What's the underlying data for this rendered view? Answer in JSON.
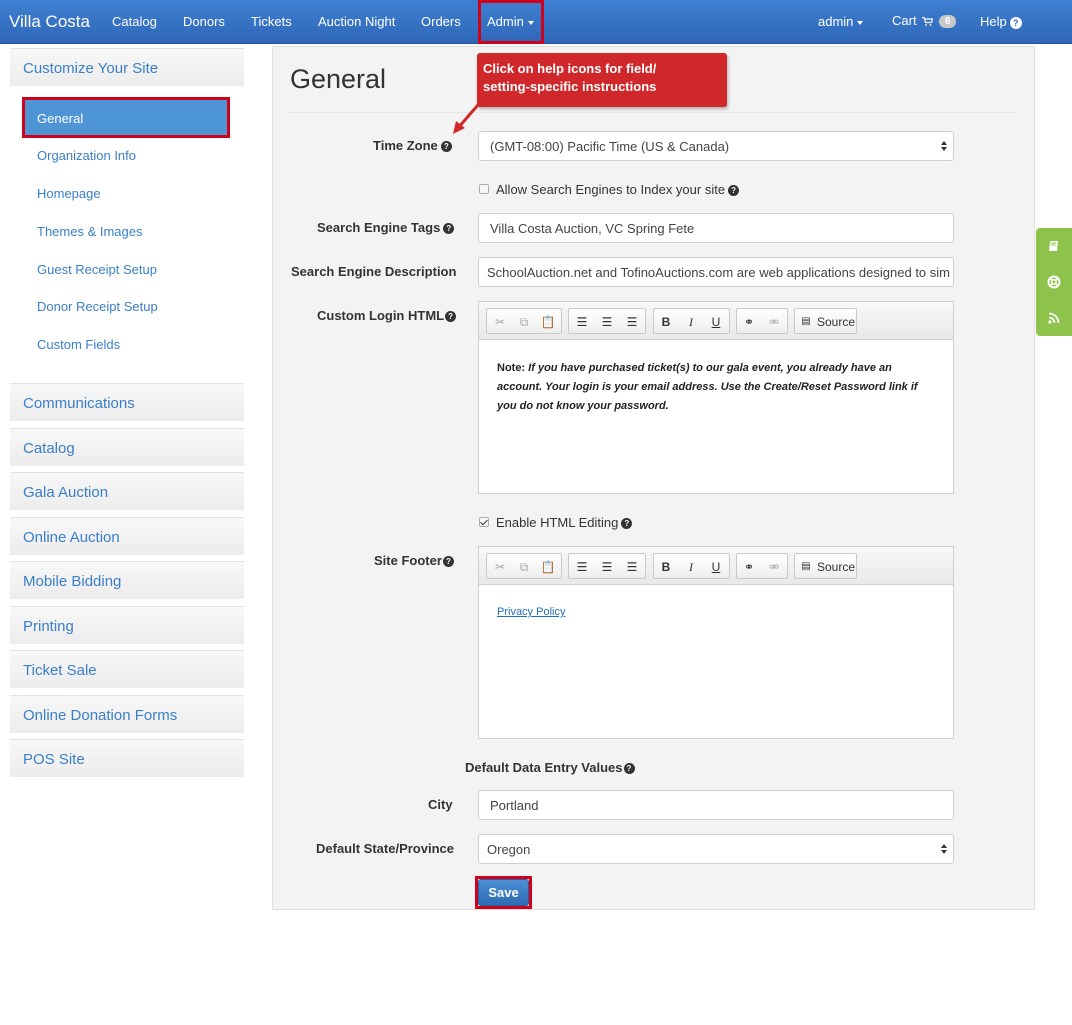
{
  "navbar": {
    "brand": "Villa Costa",
    "links": [
      "Catalog",
      "Donors",
      "Tickets",
      "Auction Night",
      "Orders"
    ],
    "admin": "Admin",
    "user": "admin",
    "cart": "Cart",
    "cart_count": "6",
    "help": "Help"
  },
  "sidebar": {
    "section_customize": "Customize Your Site",
    "items": [
      "General",
      "Organization Info",
      "Homepage",
      "Themes & Images",
      "Guest Receipt Setup",
      "Donor Receipt Setup",
      "Custom Fields"
    ],
    "sections": [
      "Communications",
      "Catalog",
      "Gala Auction",
      "Online Auction",
      "Mobile Bidding",
      "Printing",
      "Ticket Sale",
      "Online Donation Forms",
      "POS Site"
    ]
  },
  "main": {
    "title": "General",
    "callout_line1": "Click on help icons for field/",
    "callout_line2": "setting-specific instructions",
    "time_zone_label": "Time Zone",
    "time_zone_value": "(GMT-08:00) Pacific Time (US & Canada)",
    "allow_index_label": "Allow Search Engines to Index your site",
    "tags_label": "Search Engine Tags",
    "tags_value": "Villa Costa Auction,  VC Spring Fete",
    "description_label": "Search Engine Description",
    "description_value": "SchoolAuction.net and TofinoAuctions.com are web applications designed to sim",
    "login_html_label": "Custom Login HTML",
    "login_html_note": "Note:",
    "login_html_text": "If you have purchased ticket(s) to our gala event, you already have an account.  Your login is your email address.  Use the Create/Reset Password link if you do not know your password.",
    "source_label": "Source",
    "enable_html_label": "Enable HTML Editing",
    "footer_label": "Site Footer",
    "footer_link": "Privacy Policy",
    "defaults_heading": "Default Data Entry Values",
    "city_label": "City",
    "city_value": "Portland",
    "state_label": "Default State/Province",
    "state_value": "Oregon",
    "save_label": "Save"
  }
}
